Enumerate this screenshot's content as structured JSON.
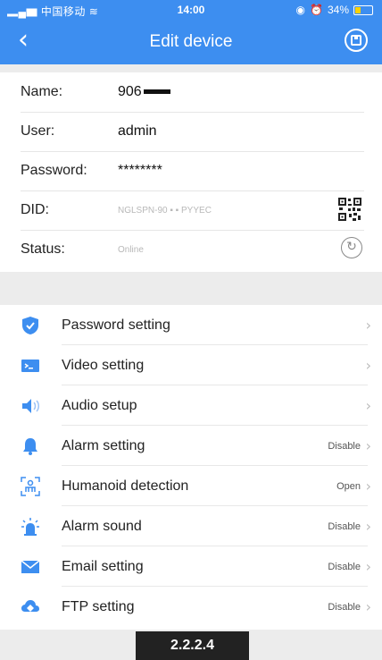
{
  "status_bar": {
    "carrier": "中国移动",
    "time": "14:00",
    "battery": "34%",
    "battery_level": 0.34
  },
  "nav": {
    "title": "Edit device"
  },
  "info": {
    "name_label": "Name:",
    "name_value": "906",
    "user_label": "User:",
    "user_value": "admin",
    "password_label": "Password:",
    "password_value": "********",
    "did_label": "DID:",
    "did_value": "NGLSPN-90",
    "did_value_tail": "PYYEC",
    "status_label": "Status:",
    "status_value": "Online"
  },
  "menu": [
    {
      "label": "Password setting",
      "value": "",
      "icon": "shield-icon"
    },
    {
      "label": "Video setting",
      "value": "",
      "icon": "video-icon"
    },
    {
      "label": "Audio setup",
      "value": "",
      "icon": "speaker-icon"
    },
    {
      "label": "Alarm setting",
      "value": "Disable",
      "icon": "bell-icon"
    },
    {
      "label": "Humanoid detection",
      "value": "Open",
      "icon": "humanoid-icon"
    },
    {
      "label": "Alarm sound",
      "value": "Disable",
      "icon": "siren-icon"
    },
    {
      "label": "Email setting",
      "value": "Disable",
      "icon": "mail-icon"
    },
    {
      "label": "FTP setting",
      "value": "Disable",
      "icon": "cloud-icon"
    }
  ],
  "version": "2.2.2.4",
  "colors": {
    "accent": "#3d8ef0",
    "background": "#ececec"
  }
}
